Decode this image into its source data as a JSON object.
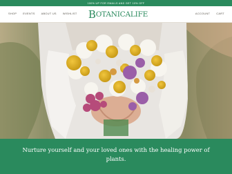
{
  "announcement": "100% UP FOR EMAILS AND GET 10% OFF",
  "nav": {
    "left": [
      "SHOP",
      "EVENTS",
      "ABOUT US",
      "WISHLIST"
    ],
    "right": [
      "ACCOUNT",
      "CART"
    ]
  },
  "brand": {
    "logo_initial": "B",
    "logo_rest": "OTANICALIFE",
    "color": "#2a8a5d"
  },
  "hero": {
    "subject": "hands holding a bouquet of daisies, chamomile and wildflowers"
  },
  "banner": {
    "tagline": "Nurture yourself and your loved ones with the healing power of plants."
  }
}
